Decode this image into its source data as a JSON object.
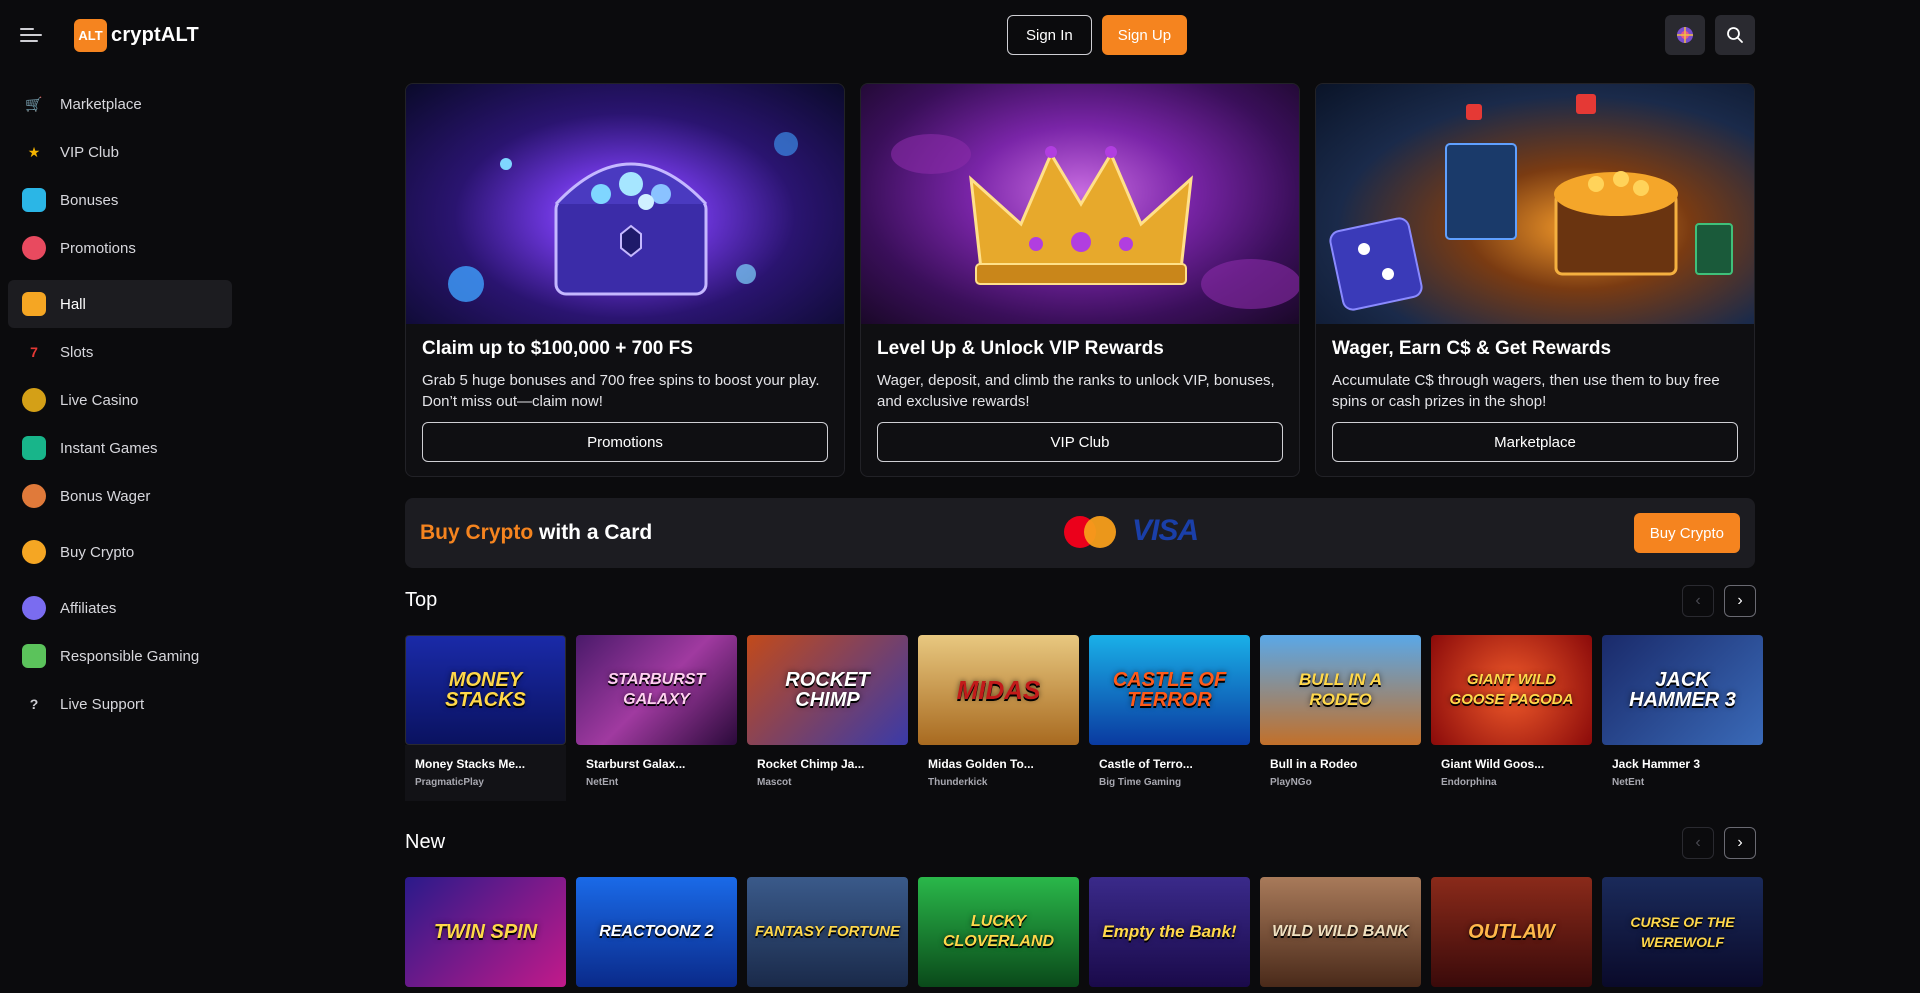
{
  "brand": {
    "badge": "ALT",
    "name": "cryptALT",
    "accent": "#f5841f"
  },
  "header": {
    "sign_in": "Sign In",
    "sign_up": "Sign Up"
  },
  "sidebar": {
    "items": [
      {
        "label": "Marketplace",
        "icon": "cart-icon",
        "color": "#e53935"
      },
      {
        "label": "VIP Club",
        "icon": "star-icon",
        "color": "#f5b400"
      },
      {
        "label": "Bonuses",
        "icon": "gift-icon",
        "color": "#2bb6e6"
      },
      {
        "label": "Promotions",
        "icon": "promo-icon",
        "color": "#e84a5f"
      },
      {
        "label": "Hall",
        "icon": "hall-icon",
        "color": "#f5a623"
      },
      {
        "label": "Slots",
        "icon": "slots-icon",
        "color": "#e53935"
      },
      {
        "label": "Live Casino",
        "icon": "chips-icon",
        "color": "#d4a017"
      },
      {
        "label": "Instant Games",
        "icon": "cards-icon",
        "color": "#18b58a"
      },
      {
        "label": "Bonus Wager",
        "icon": "moneybag-icon",
        "color": "#e07a3a"
      },
      {
        "label": "Buy Crypto",
        "icon": "coin-icon",
        "color": "#f5a623"
      },
      {
        "label": "Affiliates",
        "icon": "people-icon",
        "color": "#7a6cf0"
      },
      {
        "label": "Responsible Gaming",
        "icon": "shield-icon",
        "color": "#5bc35b"
      },
      {
        "label": "Live Support",
        "icon": "help-icon",
        "color": "#cfcfd4"
      }
    ]
  },
  "promos": [
    {
      "title": "Claim up to $100,000 + 700 FS",
      "desc": "Grab 5 huge bonuses and 700 free spins to boost your play. Don’t miss out—claim now!",
      "button": "Promotions",
      "image": "treasure-chest"
    },
    {
      "title": "Level Up & Unlock VIP Rewards",
      "desc": "Wager, deposit, and climb the ranks to unlock VIP, bonuses, and exclusive rewards!",
      "button": "VIP Club",
      "image": "golden-crown"
    },
    {
      "title": "Wager, Earn C$ & Get Rewards",
      "desc": "Accumulate C$ through wagers, then use them to buy free spins or cash prizes in the shop!",
      "button": "Marketplace",
      "image": "dice-and-coins"
    }
  ],
  "crypto": {
    "title_highlight": "Buy Crypto",
    "title_rest": " with a Card",
    "visa": "VISA",
    "button": "Buy Crypto"
  },
  "sections": {
    "top": {
      "title": "Top",
      "games": [
        {
          "name": "Money Stacks Me...",
          "provider": "PragmaticPlay",
          "art": "MONEY STACKS"
        },
        {
          "name": "Starburst Galax...",
          "provider": "NetEnt",
          "art": "STARBURST GALAXY"
        },
        {
          "name": "Rocket Chimp Ja...",
          "provider": "Mascot",
          "art": "ROCKET CHIMP"
        },
        {
          "name": "Midas Golden To...",
          "provider": "Thunderkick",
          "art": "MIDAS"
        },
        {
          "name": "Castle of Terro...",
          "provider": "Big Time Gaming",
          "art": "CASTLE OF TERROR"
        },
        {
          "name": "Bull in a Rodeo",
          "provider": "PlayNGo",
          "art": "BULL IN A RODEO"
        },
        {
          "name": "Giant Wild Goos...",
          "provider": "Endorphina",
          "art": "GIANT WILD GOOSE PAGODA"
        },
        {
          "name": "Jack Hammer 3",
          "provider": "NetEnt",
          "art": "JACK HAMMER 3"
        }
      ]
    },
    "new": {
      "title": "New",
      "games": [
        {
          "art": "TWIN SPIN"
        },
        {
          "art": "REACTOONZ 2"
        },
        {
          "art": "FANTASY FORTUNE"
        },
        {
          "art": "LUCKY CLOVERLAND"
        },
        {
          "art": "Empty the Bank!"
        },
        {
          "art": "WILD WILD BANK"
        },
        {
          "art": "OUTLAW"
        },
        {
          "art": "CURSE OF THE WEREWOLF"
        }
      ]
    }
  }
}
